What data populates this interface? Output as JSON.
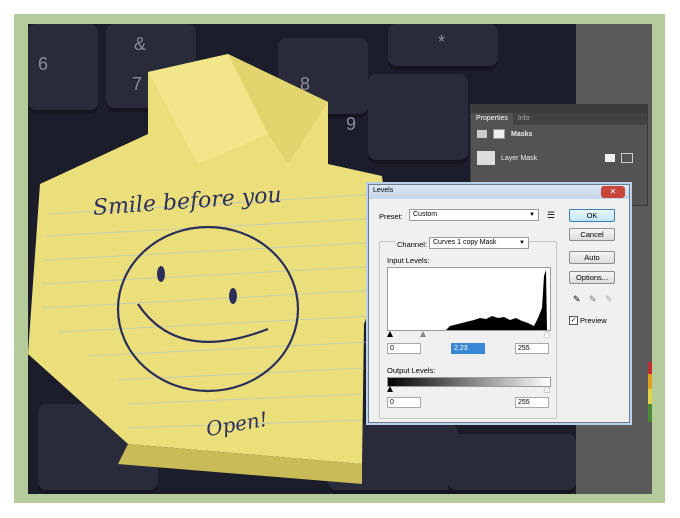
{
  "properties_panel": {
    "tabs": [
      "Properties",
      "Info"
    ],
    "masks_label": "Masks",
    "layer_mask_label": "Layer Mask"
  },
  "levels_dialog": {
    "title": "Levels",
    "close_glyph": "✕",
    "preset_label": "Preset:",
    "preset_value": "Custom",
    "channel_label": "Channel:",
    "channel_value": "Curves 1 copy Mask",
    "input_levels_label": "Input Levels:",
    "input_black": "0",
    "input_gamma": "2.23",
    "input_white": "255",
    "output_levels_label": "Output Levels:",
    "output_black": "0",
    "output_white": "255",
    "buttons": {
      "ok": "OK",
      "cancel": "Cancel",
      "auto": "Auto",
      "options": "Options..."
    },
    "preview_label": "Preview",
    "preview_checked": true
  },
  "note": {
    "line1": "Smile before you",
    "line2": "Open!"
  },
  "keyboard_keys": [
    "6",
    "&",
    "7",
    "8",
    "9",
    "*"
  ]
}
